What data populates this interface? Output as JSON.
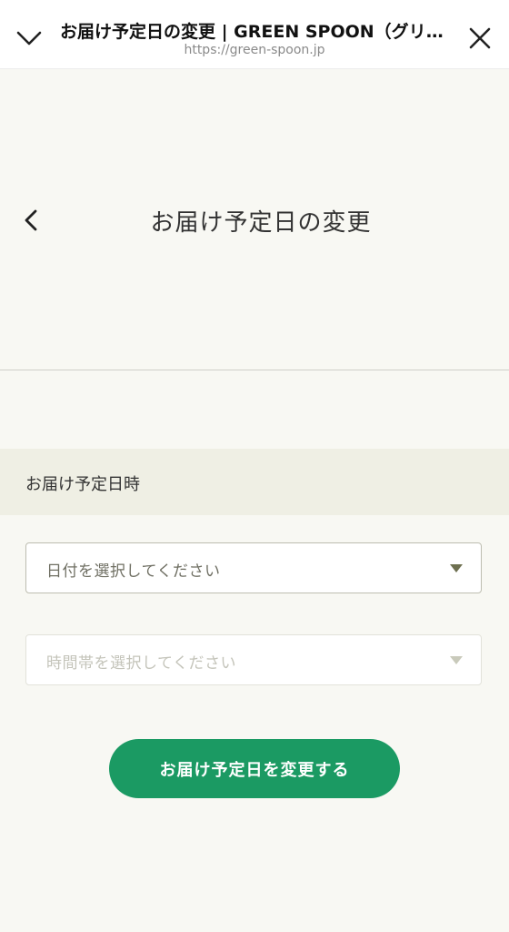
{
  "browser": {
    "title": "お届け予定日の変更 | GREEN SPOON（グリーンスプーン）",
    "url": "https://green-spoon.jp",
    "collapse_icon": "chevron-down-icon",
    "close_icon": "close-icon"
  },
  "header": {
    "back_icon": "chevron-left-icon",
    "title": "お届け予定日の変更"
  },
  "delivery": {
    "section_label": "お届け予定日時",
    "date_select": {
      "placeholder": "日付を選択してください",
      "enabled": true
    },
    "time_select": {
      "placeholder": "時間帯を選択してください",
      "enabled": false
    }
  },
  "actions": {
    "submit_label": "お届け予定日を変更する"
  },
  "colors": {
    "background": "#f8f8f3",
    "section_band": "#efefe4",
    "primary_button": "#1b9a63",
    "caret_active": "#6e7050",
    "caret_disabled": "#c9cabb"
  }
}
